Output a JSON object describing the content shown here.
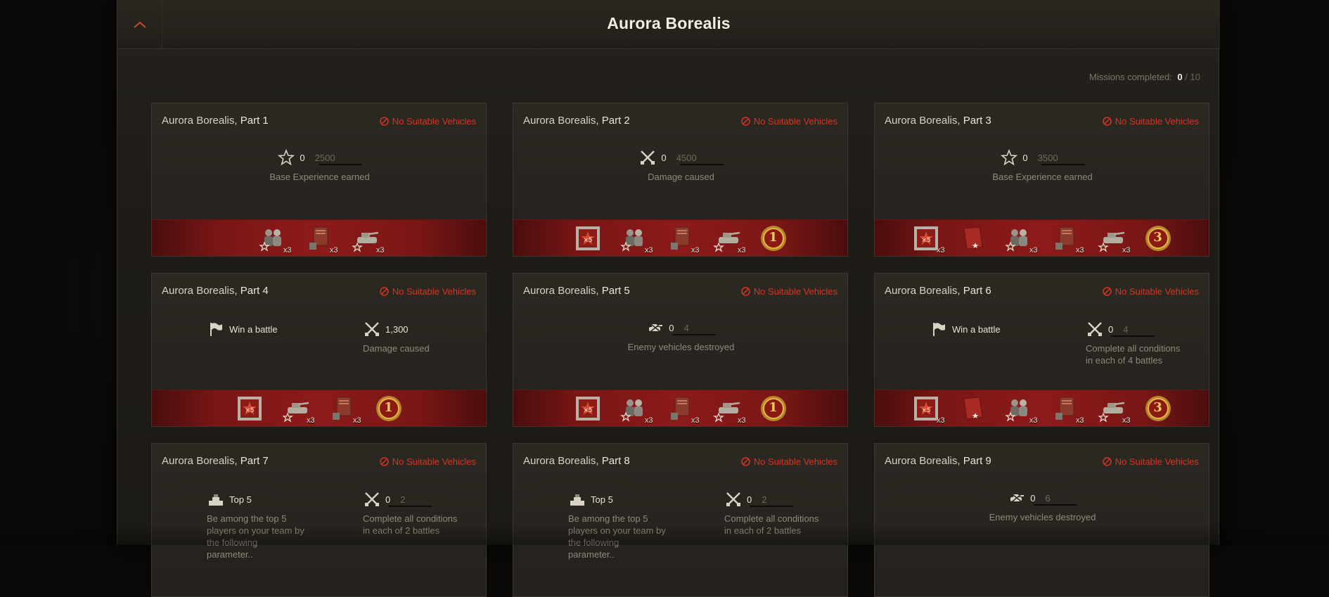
{
  "header": {
    "title": "Aurora Borealis",
    "collapse_icon": "chevron-up-icon"
  },
  "progress": {
    "label": "Missions completed:",
    "completed": "0",
    "separator": "/",
    "total": "10"
  },
  "colors": {
    "warning": "#e0301e",
    "reward_strip": "#8d1a1a",
    "accent": "#c98a2a"
  },
  "missions": [
    {
      "title_prefix": "Aurora Borealis,",
      "title_part": "Part 1",
      "warning": "No Suitable Vehicles",
      "conditions": [
        {
          "icon": "star-icon",
          "value": "0",
          "goal": "2500",
          "label": "Base Experience earned"
        }
      ],
      "rewards": [
        {
          "icon": "crew-icon",
          "count": "x3"
        },
        {
          "icon": "manual-icon",
          "count": "x3"
        },
        {
          "icon": "tank-icon",
          "count": "x3"
        }
      ]
    },
    {
      "title_prefix": "Aurora Borealis,",
      "title_part": "Part 2",
      "warning": "No Suitable Vehicles",
      "conditions": [
        {
          "icon": "crossed-swords-icon",
          "value": "0",
          "goal": "4500",
          "label": "Damage caused"
        }
      ],
      "rewards": [
        {
          "icon": "booster-icon",
          "count": ""
        },
        {
          "icon": "crew-icon",
          "count": "x3"
        },
        {
          "icon": "manual-icon",
          "count": "x3"
        },
        {
          "icon": "tank-icon",
          "count": "x3"
        },
        {
          "icon": "medal-icon",
          "count": "",
          "medal_number": "1"
        }
      ]
    },
    {
      "title_prefix": "Aurora Borealis,",
      "title_part": "Part 3",
      "warning": "No Suitable Vehicles",
      "conditions": [
        {
          "icon": "star-icon",
          "value": "0",
          "goal": "3500",
          "label": "Base Experience earned"
        }
      ],
      "rewards": [
        {
          "icon": "booster-icon",
          "count": "x3"
        },
        {
          "icon": "red-book-icon",
          "count": ""
        },
        {
          "icon": "crew-icon",
          "count": "x3"
        },
        {
          "icon": "manual-icon",
          "count": "x3"
        },
        {
          "icon": "tank-icon",
          "count": "x3"
        },
        {
          "icon": "medal-icon",
          "count": "",
          "medal_number": "3"
        }
      ]
    },
    {
      "title_prefix": "Aurora Borealis,",
      "title_part": "Part 4",
      "warning": "No Suitable Vehicles",
      "conditions": [
        {
          "icon": "flag-icon",
          "value": "Win a battle",
          "goal": "",
          "label": ""
        },
        {
          "icon": "crossed-swords-icon",
          "value": "1,300",
          "goal": "",
          "label": "Damage caused"
        }
      ],
      "rewards": [
        {
          "icon": "booster-icon",
          "count": ""
        },
        {
          "icon": "tank-icon",
          "count": "x3"
        },
        {
          "icon": "manual-icon",
          "count": "x3"
        },
        {
          "icon": "medal-icon",
          "count": "",
          "medal_number": "1"
        }
      ]
    },
    {
      "title_prefix": "Aurora Borealis,",
      "title_part": "Part 5",
      "warning": "No Suitable Vehicles",
      "conditions": [
        {
          "icon": "destroyed-tank-icon",
          "value": "0",
          "goal": "4",
          "label": "Enemy vehicles destroyed"
        }
      ],
      "rewards": [
        {
          "icon": "booster-icon",
          "count": ""
        },
        {
          "icon": "crew-icon",
          "count": "x3"
        },
        {
          "icon": "manual-icon",
          "count": "x3"
        },
        {
          "icon": "tank-icon",
          "count": "x3"
        },
        {
          "icon": "medal-icon",
          "count": "",
          "medal_number": "1"
        }
      ]
    },
    {
      "title_prefix": "Aurora Borealis,",
      "title_part": "Part 6",
      "warning": "No Suitable Vehicles",
      "conditions": [
        {
          "icon": "flag-icon",
          "value": "Win a battle",
          "goal": "",
          "label": ""
        },
        {
          "icon": "crossed-swords-icon",
          "value": "0",
          "goal": "4",
          "label": "Complete all conditions\nin each of 4 battles"
        }
      ],
      "rewards": [
        {
          "icon": "booster-icon",
          "count": "x3"
        },
        {
          "icon": "red-book-icon",
          "count": ""
        },
        {
          "icon": "crew-icon",
          "count": "x3"
        },
        {
          "icon": "manual-icon",
          "count": "x3"
        },
        {
          "icon": "tank-icon",
          "count": "x3"
        },
        {
          "icon": "medal-icon",
          "count": "",
          "medal_number": "3"
        }
      ]
    },
    {
      "title_prefix": "Aurora Borealis,",
      "title_part": "Part 7",
      "warning": "No Suitable Vehicles",
      "conditions": [
        {
          "icon": "podium-icon",
          "value": "Top 5",
          "goal": "",
          "label": "Be among the top 5\nplayers on your team by\nthe following parameter.."
        },
        {
          "icon": "crossed-swords-icon",
          "value": "0",
          "goal": "2",
          "label": "Complete all conditions\nin each of 2 battles"
        }
      ],
      "rewards": []
    },
    {
      "title_prefix": "Aurora Borealis,",
      "title_part": "Part 8",
      "warning": "No Suitable Vehicles",
      "conditions": [
        {
          "icon": "podium-icon",
          "value": "Top 5",
          "goal": "",
          "label": "Be among the top 5\nplayers on your team by\nthe following parameter.."
        },
        {
          "icon": "crossed-swords-icon",
          "value": "0",
          "goal": "2",
          "label": "Complete all conditions\nin each of 2 battles"
        }
      ],
      "rewards": []
    },
    {
      "title_prefix": "Aurora Borealis,",
      "title_part": "Part 9",
      "warning": "No Suitable Vehicles",
      "conditions": [
        {
          "icon": "destroyed-tank-icon",
          "value": "0",
          "goal": "6",
          "label": "Enemy vehicles destroyed"
        }
      ],
      "rewards": []
    }
  ]
}
